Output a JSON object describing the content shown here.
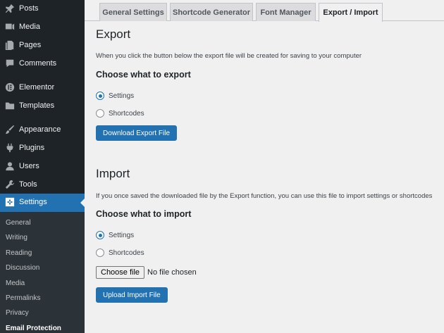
{
  "sidebar": {
    "items": [
      {
        "label": "Posts",
        "icon": "pin-icon"
      },
      {
        "label": "Media",
        "icon": "media-icon"
      },
      {
        "label": "Pages",
        "icon": "pages-icon"
      },
      {
        "label": "Comments",
        "icon": "comments-icon"
      },
      {
        "label": "Elementor",
        "icon": "elementor-icon"
      },
      {
        "label": "Templates",
        "icon": "folder-icon"
      },
      {
        "label": "Appearance",
        "icon": "brush-icon"
      },
      {
        "label": "Plugins",
        "icon": "plugin-icon"
      },
      {
        "label": "Users",
        "icon": "users-icon"
      },
      {
        "label": "Tools",
        "icon": "wrench-icon"
      },
      {
        "label": "Settings",
        "icon": "settings-icon"
      }
    ],
    "submenu": [
      "General",
      "Writing",
      "Reading",
      "Discussion",
      "Media",
      "Permalinks",
      "Privacy",
      "Email Protection"
    ]
  },
  "tabs": [
    "General Settings",
    "Shortcode Generator",
    "Font Manager",
    "Export / Import"
  ],
  "export": {
    "title": "Export",
    "description": "When you click the button below the export file will be created for saving to your computer",
    "choose": "Choose what to export",
    "options": [
      "Settings",
      "Shortcodes"
    ],
    "button": "Download Export File"
  },
  "import": {
    "title": "Import",
    "description": "If you once saved the downloaded file by the Export function, you can use this file to import settings or shortcodes",
    "choose": "Choose what to import",
    "options": [
      "Settings",
      "Shortcodes"
    ],
    "file_button": "Choose file",
    "file_status": "No file chosen",
    "button": "Upload Import File"
  },
  "colors": {
    "accent": "#2271b1",
    "sidebar": "#1d2327",
    "background": "#f0f0f1"
  }
}
